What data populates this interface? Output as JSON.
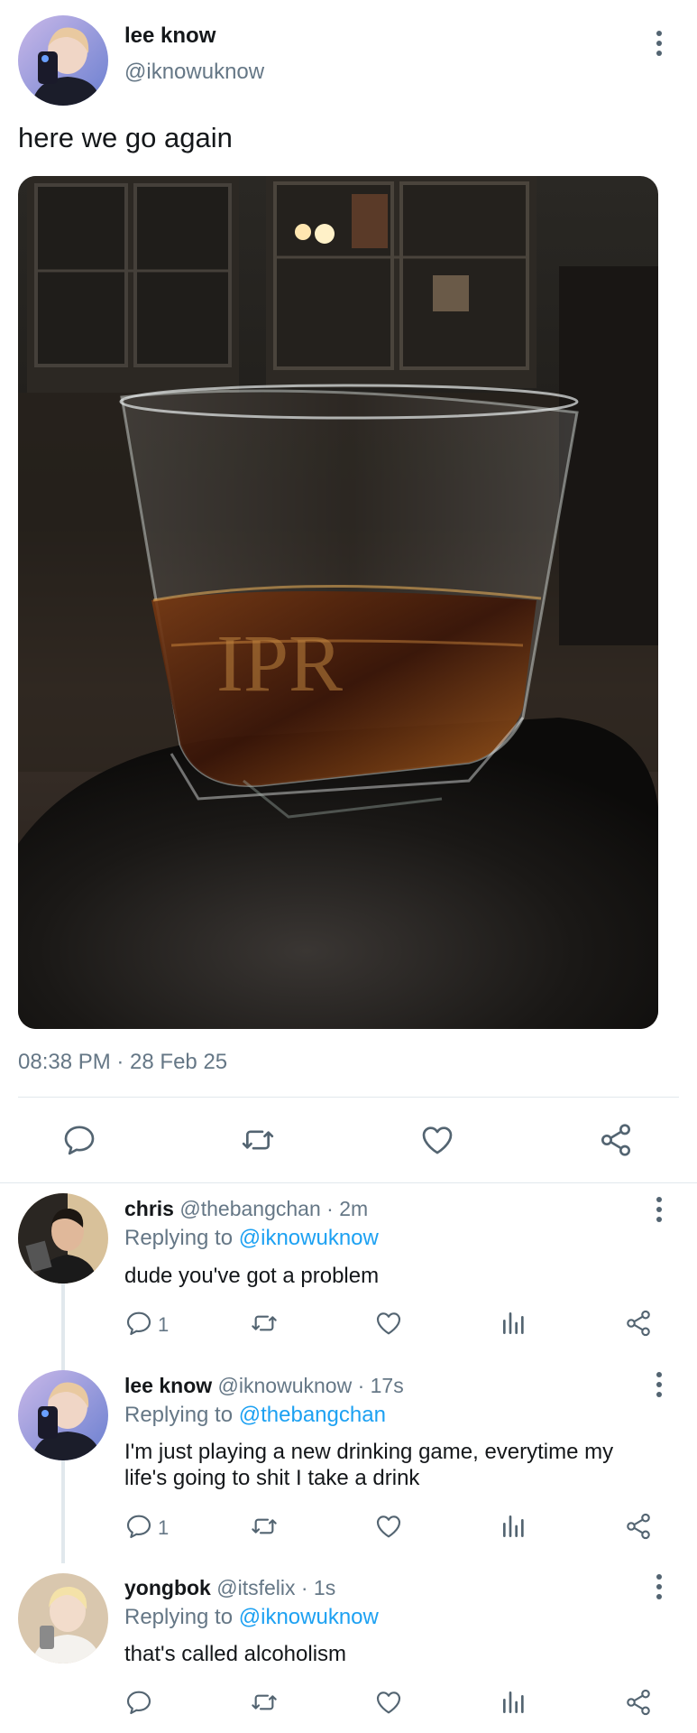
{
  "main_tweet": {
    "author_name": "lee know",
    "author_handle": "@iknowuknow",
    "text": "here we go again",
    "timestamp": "08:38 PM · 28 Feb 25",
    "photo_label": "IPR",
    "icons": [
      "comment-icon",
      "retweet-icon",
      "like-icon",
      "share-icon"
    ]
  },
  "replies": [
    {
      "name": "chris",
      "handle": "@thebangchan",
      "time": " · 2m",
      "replying_prefix": "Replying to ",
      "replying_to": "@iknowuknow",
      "text": "dude you've got a problem",
      "reply_count": "1"
    },
    {
      "name": "lee know",
      "handle": "@iknowuknow",
      "time": " · 17s",
      "replying_prefix": "Replying to ",
      "replying_to": "@thebangchan",
      "text_line1": "I'm just playing a new drinking game, everytime my",
      "text_line2": "life's going to shit I take a drink",
      "reply_count": "1"
    },
    {
      "name": "yongbok",
      "handle": "@itsfelix",
      "time": " · 1s",
      "replying_prefix": "Replying to ",
      "replying_to": "@iknowuknow",
      "text": "that's called alcoholism",
      "reply_count": ""
    }
  ],
  "colors": {
    "accent": "#1da1f2",
    "muted": "#657786",
    "divider": "#e1e8ed"
  }
}
